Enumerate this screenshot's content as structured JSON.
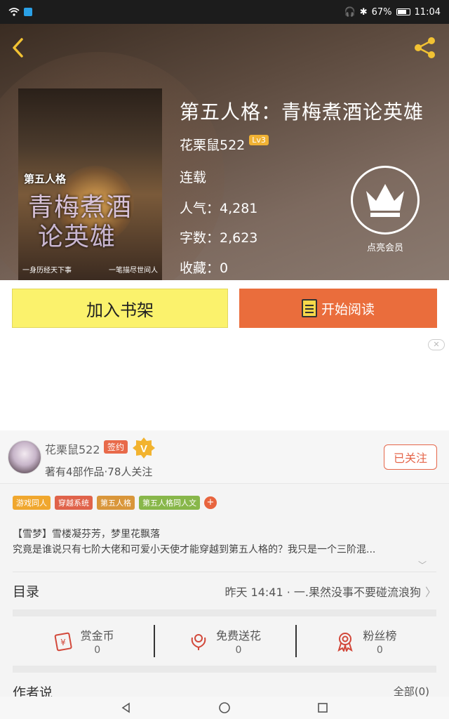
{
  "status_bar": {
    "battery": "67%",
    "time": "11:04"
  },
  "book": {
    "title": "第五人格：青梅煮酒论英雄",
    "author": "花栗鼠522",
    "level": "Lv3",
    "status": "连载",
    "popularity": "人气：4,281",
    "word_count": "字数：2,623",
    "favorites": "收藏：0"
  },
  "cover": {
    "small_title": "第五人格",
    "big_title_line1": "青梅煮酒",
    "big_title_line2": "论英雄",
    "footer_left": "一身历经天下事",
    "footer_right": "一笔描尽世间人"
  },
  "vip": {
    "label": "点亮会员"
  },
  "actions": {
    "add_shelf": "加入书架",
    "start_read": "开始阅读"
  },
  "author_card": {
    "name": "花栗鼠522",
    "sign_badge": "签约",
    "v_badge": "V",
    "subtitle": "著有4部作品·78人关注",
    "follow_label": "已关注"
  },
  "tags": [
    {
      "label": "游戏同人",
      "color": "#f0a72e"
    },
    {
      "label": "穿越系统",
      "color": "#e0634a"
    },
    {
      "label": "第五人格",
      "color": "#d9963a"
    },
    {
      "label": "第五人格同人文",
      "color": "#88b74a"
    }
  ],
  "tag_more": "+",
  "intro": {
    "line1": "【雪梦】雪楼凝芬芳，梦里花飘落",
    "line2": "究竟是谁说只有七阶大佬和可爱小天使才能穿越到第五人格的？我只是一个三阶混..."
  },
  "catalog": {
    "title": "目录",
    "latest": "昨天 14:41 · 一.果然没事不要碰流浪狗"
  },
  "stats": [
    {
      "label": "赏金币",
      "count": "0",
      "icon": "coin-icon"
    },
    {
      "label": "免费送花",
      "count": "0",
      "icon": "flower-icon"
    },
    {
      "label": "粉丝榜",
      "count": "0",
      "icon": "medal-icon"
    }
  ],
  "author_says": {
    "title": "作者说",
    "all": "全部(0)"
  },
  "colors": {
    "accent_orange": "#ea6d3c",
    "shelf_yellow": "#fbf26c",
    "follow_red": "#e5664a"
  }
}
